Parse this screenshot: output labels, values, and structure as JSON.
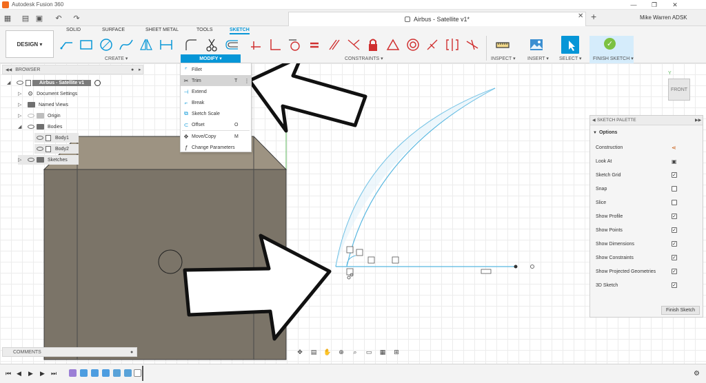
{
  "titlebar": {
    "app_title": "Autodesk Fusion 360",
    "minimize": "—",
    "maximize": "❐",
    "close": "✕"
  },
  "tabbar": {
    "doc_title": "Airbus - Satellite v1*",
    "close_icon": "✕",
    "new_tab": "+",
    "user": "Mike Warren ADSK",
    "quick_access": {
      "grid": "▦",
      "file": "▤",
      "save": "▣",
      "undo": "↶",
      "redo": "↷"
    }
  },
  "toolbar": {
    "design_label": "DESIGN ▾",
    "tabs": [
      "SOLID",
      "SURFACE",
      "SHEET METAL",
      "TOOLS",
      "SKETCH"
    ],
    "groups": {
      "create": "CREATE ▾",
      "modify": "MODIFY ▾",
      "constraints": "CONSTRAINTS ▾",
      "inspect": "INSPECT ▾",
      "insert": "INSERT ▾",
      "select": "SELECT ▾",
      "finish": "FINISH SKETCH ▾"
    },
    "finish_check": "✓"
  },
  "browser": {
    "header": "BROWSER",
    "root": "Airbus - Satellite v1",
    "items": {
      "document_settings": "Document Settings",
      "named_views": "Named Views",
      "origin": "Origin",
      "bodies": "Bodies",
      "body1": "Body1",
      "body2": "Body2",
      "sketches": "Sketches"
    }
  },
  "modify_menu": {
    "items": [
      {
        "label": "Fillet",
        "key": ""
      },
      {
        "label": "Trim",
        "key": "T"
      },
      {
        "label": "Extend",
        "key": ""
      },
      {
        "label": "Break",
        "key": ""
      },
      {
        "label": "Sketch Scale",
        "key": ""
      },
      {
        "label": "Offset",
        "key": "O"
      },
      {
        "label": "Move/Copy",
        "key": "M"
      },
      {
        "label": "Change Parameters",
        "key": ""
      }
    ],
    "selected": "Trim"
  },
  "viewcube": {
    "label": "FRONT",
    "axis_label": "Y"
  },
  "sketch_palette": {
    "header": "SKETCH PALETTE",
    "section": "Options",
    "options": [
      {
        "label": "Construction",
        "type": "icon"
      },
      {
        "label": "Look At",
        "type": "icon"
      },
      {
        "label": "Sketch Grid",
        "checked": true
      },
      {
        "label": "Snap",
        "checked": false
      },
      {
        "label": "Slice",
        "checked": false
      },
      {
        "label": "Show Profile",
        "checked": true
      },
      {
        "label": "Show Points",
        "checked": true
      },
      {
        "label": "Show Dimensions",
        "checked": true
      },
      {
        "label": "Show Constraints",
        "checked": true
      },
      {
        "label": "Show Projected Geometries",
        "checked": true
      },
      {
        "label": "3D Sketch",
        "checked": true
      }
    ],
    "finish_button": "Finish Sketch"
  },
  "comments": {
    "label": "COMMENTS"
  },
  "timeline": {
    "controls": [
      "⏮",
      "◀",
      "▶",
      "▶",
      "⏭"
    ]
  },
  "colors": {
    "accent": "#0696d7",
    "sketch_line": "#58b7e0",
    "box_face": "#7a7266",
    "box_top": "#9a9080",
    "finish_green": "#7cc142"
  }
}
